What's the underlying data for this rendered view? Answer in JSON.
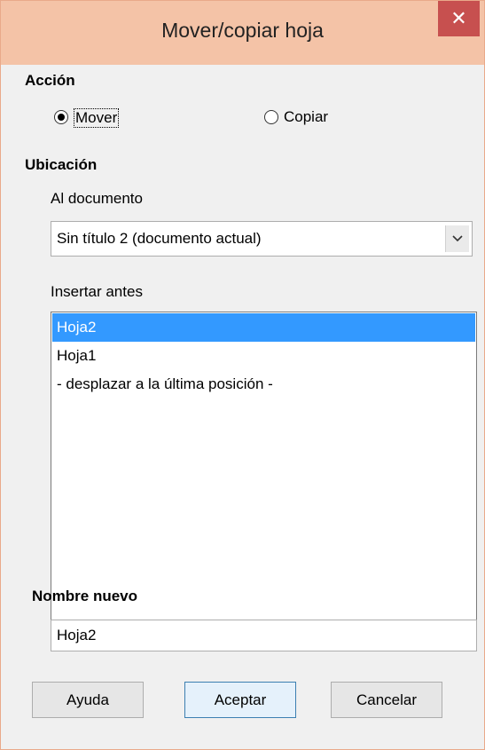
{
  "window": {
    "title": "Mover/copiar hoja",
    "close_glyph": "✕"
  },
  "accion": {
    "heading": "Acción",
    "options": [
      {
        "label": "Mover",
        "selected": true
      },
      {
        "label": "Copiar",
        "selected": false
      }
    ]
  },
  "ubicacion": {
    "heading": "Ubicación",
    "document_label": "Al documento",
    "document_value": "Sin título 2 (documento actual)",
    "insert_label": "Insertar antes",
    "items": [
      {
        "label": "Hoja2",
        "selected": true
      },
      {
        "label": "Hoja1",
        "selected": false
      },
      {
        "label": "- desplazar a la última posición -",
        "selected": false
      }
    ]
  },
  "nombre": {
    "label": "Nombre nuevo",
    "value": "Hoja2"
  },
  "buttons": {
    "help": "Ayuda",
    "ok": "Aceptar",
    "cancel": "Cancelar"
  },
  "colors": {
    "selection": "#3399ff",
    "titlebar": "#f4c3a7",
    "close": "#c7504f"
  }
}
